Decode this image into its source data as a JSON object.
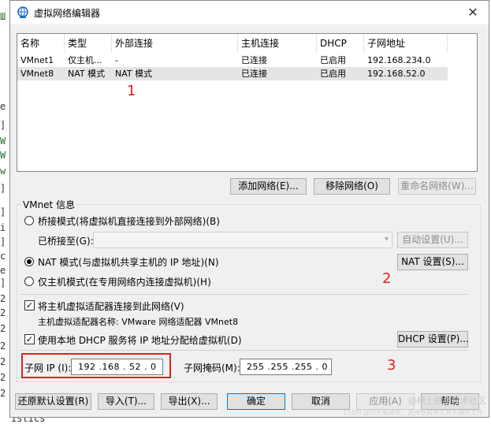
{
  "title": "虚拟网络编辑器",
  "background": {
    "left_chars": [
      "Ш",
      "Ш",
      "W",
      "W",
      "",
      "",
      "Ш",
      "Ш",
      "",
      "",
      "",
      "",
      "",
      "",
      "",
      "",
      "",
      "",
      "",
      "",
      "",
      ""
    ],
    "bottom_text": "istics"
  },
  "list": {
    "columns": [
      "名称",
      "类型",
      "外部连接",
      "主机连接",
      "DHCP",
      "子网地址"
    ],
    "rows": [
      {
        "name": "VMnet1",
        "type": "仅主机...",
        "external": "-",
        "host": "已连接",
        "dhcp": "已启用",
        "subnet": "192.168.234.0"
      },
      {
        "name": "VMnet8",
        "type": "NAT 模式",
        "external": "NAT 模式",
        "host": "已连接",
        "dhcp": "已启用",
        "subnet": "192.168.52.0"
      }
    ]
  },
  "list_buttons": {
    "add": "添加网络(E)...",
    "remove": "移除网络(O)",
    "rename": "重命名网络(W)..."
  },
  "vmnet_info": {
    "legend": "VMnet 信息",
    "bridge_label": "桥接模式(将虚拟机直接连接到外部网络)(B)",
    "bridged_to_label": "已桥接至(G):",
    "auto_settings": "自动设置(U)...",
    "nat_label": "NAT 模式(与虚拟机共享主机的 IP 地址)(N)",
    "nat_settings": "NAT 设置(S)...",
    "hostonly_label": "仅主机模式(在专用网络内连接虚拟机)(H)",
    "connect_adapter_label": "将主机虚拟适配器连接到此网络(V)",
    "adapter_name_label": "主机虚拟适配器名称: VMware 网络适配器 VMnet8",
    "dhcp_label": "使用本地 DHCP 服务将 IP 地址分配给虚拟机(D)",
    "dhcp_settings": "DHCP 设置(P)...",
    "subnet_ip_label": "子网 IP (I):",
    "subnet_ip": "192 .168 . 52 . 0",
    "subnet_mask_label": "子网掩码(M):",
    "subnet_mask": "255 .255 .255 . 0"
  },
  "footer": {
    "restore": "还原默认设置(R)",
    "import": "导入(T)...",
    "export": "导出(X)...",
    "ok": "确定",
    "cancel": "取消",
    "apply": "应用(A)",
    "help": "帮助"
  },
  "annotations": [
    "1",
    "2",
    "3"
  ],
  "watermark": "@稀土掘金技术社区",
  "watermark_small": "CSDN @灯火阑珊处，选择既简单又有乐趣的工作"
}
